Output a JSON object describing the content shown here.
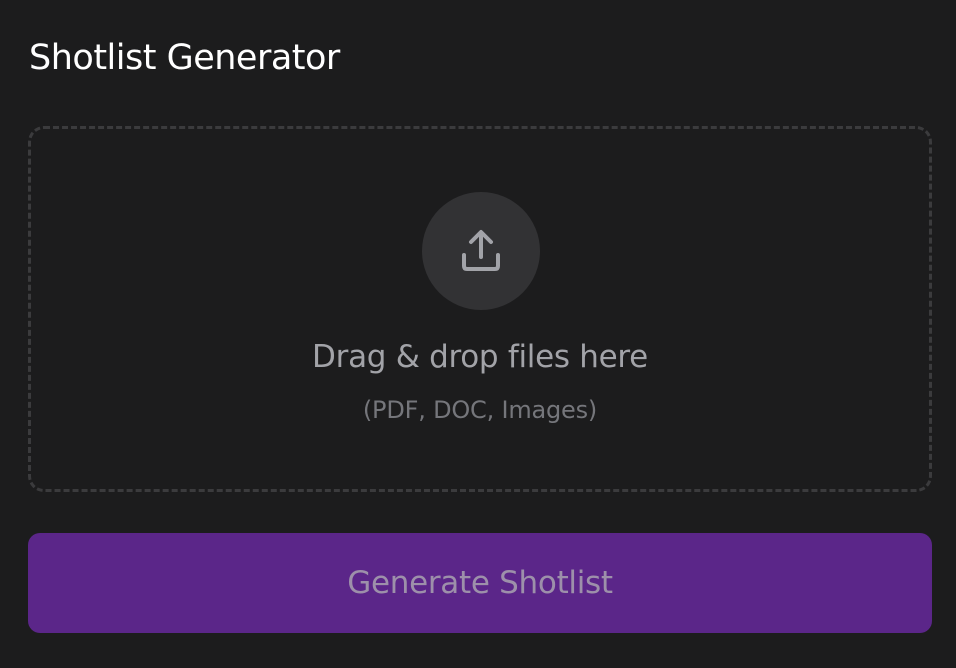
{
  "header": {
    "title": "Shotlist Generator"
  },
  "dropzone": {
    "icon": "upload-icon",
    "primary_text": "Drag & drop files here",
    "secondary_text": "(PDF, DOC, Images)"
  },
  "actions": {
    "generate_label": "Generate Shotlist"
  },
  "colors": {
    "background": "#1c1c1d",
    "dropzone_border": "#3b3b3d",
    "icon_circle": "#323234",
    "icon_stroke": "#a2a3a8",
    "button_bg": "#5b2689",
    "button_text": "#9d90aa"
  }
}
